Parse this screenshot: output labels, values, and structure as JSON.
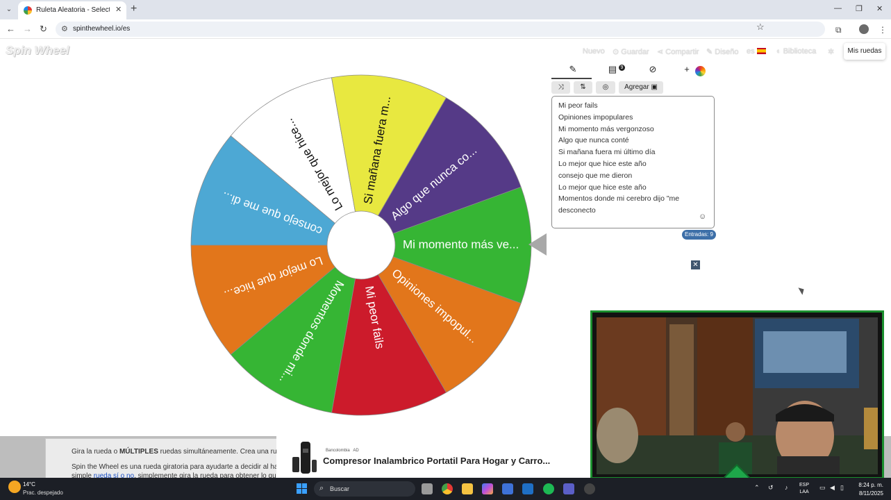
{
  "browser": {
    "tab_title": "Ruleta Aleatoria - Selector Personalizado",
    "url": "spinthewheel.io/es"
  },
  "site": {
    "logo": "Spin Wheel",
    "nav": [
      "Nuevo",
      "Guardar",
      "Compartir",
      "Diseño",
      "es",
      "Biblioteca"
    ],
    "my_wheels": "Mis ruedas"
  },
  "wheel": {
    "segments": [
      {
        "label": "Mi momento más ve...",
        "color": "#36b534"
      },
      {
        "label": "Opiniones impopul...",
        "color": "#e2761b"
      },
      {
        "label": "Mi peor fails",
        "color": "#cc1b2b"
      },
      {
        "label": "Momentos donde mi...",
        "color": "#36b534"
      },
      {
        "label": "Lo mejor que hice...",
        "color": "#e2761b"
      },
      {
        "label": "consejo que me di...",
        "color": "#4da8d4"
      },
      {
        "label": "Lo mejor que hice...",
        "color": "#ffffff"
      },
      {
        "label": "Si mañana fuera m...",
        "color": "#e8e840"
      },
      {
        "label": "Algo que nunca co...",
        "color": "#553a87"
      }
    ]
  },
  "editor": {
    "add_label": "Agregar",
    "list_badge": "9",
    "entries": [
      "Mi peor fails",
      "Opiniones impopulares",
      "Mi momento más vergonzoso",
      "Algo que nunca conté",
      "Si mañana fuera mi último día",
      "Lo mejor que hice este año",
      "consejo que me dieron",
      "Lo mejor que hice este año",
      "Momentos donde mi cerebro dijo \"me",
      "desconecto"
    ],
    "entries_count": "Entradas: 9"
  },
  "info": {
    "line1_pre": "Gira la rueda o ",
    "line1_bold": "MÚLTIPLES",
    "line1_post": " ruedas simultáneamente. Crea una rueda p",
    "line2": "Spin the Wheel es una rueda giratoria para ayudarte a decidir al hacer u",
    "line3_pre": "simple ",
    "line3_link": "rueda sí o no",
    "line3_post": ", simplemente gira la rueda para obtener lo que nec"
  },
  "ad": {
    "brand": "Bancolombia",
    "sponsored": "AD",
    "title": "Compresor Inalambrico Portatil Para Hogar y Carro..."
  },
  "taskbar": {
    "temp": "14°C",
    "weather": "Prac. despejado",
    "search": "Buscar",
    "lang_top": "ESP",
    "lang_bottom": "LAA",
    "time": "8:24 p. m.",
    "date": "8/11/2025"
  }
}
